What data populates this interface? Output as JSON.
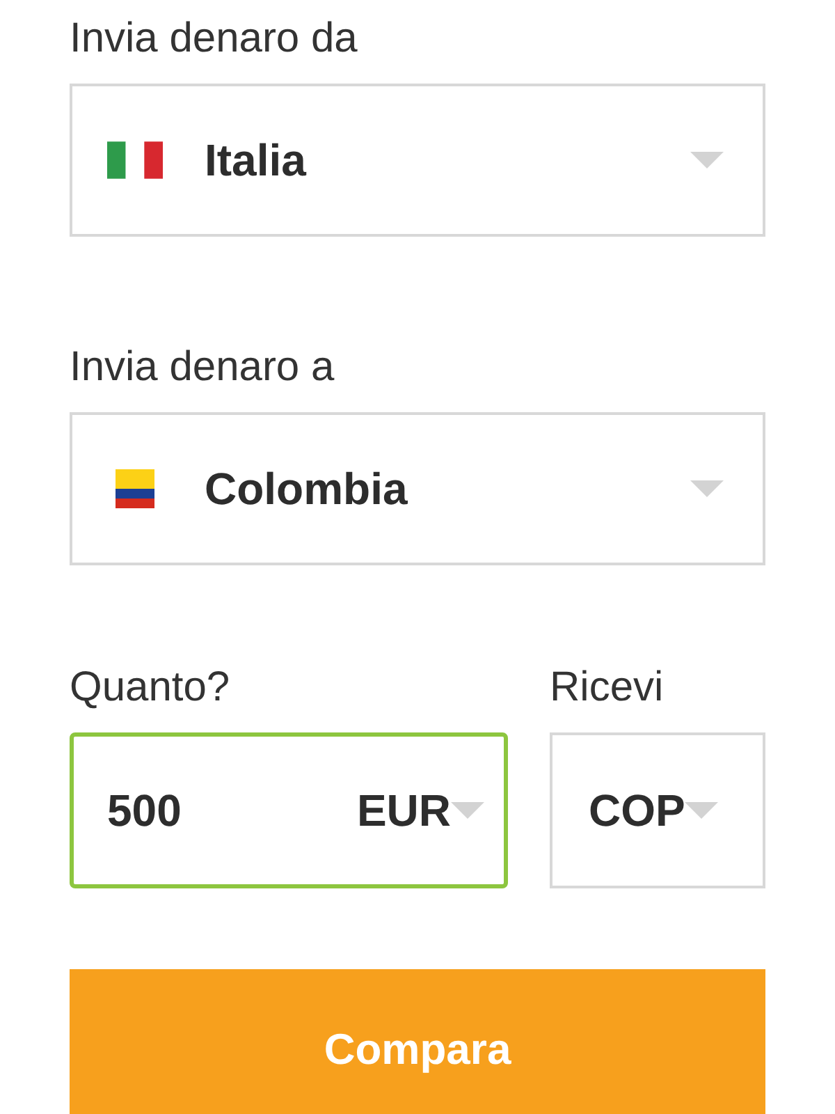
{
  "from": {
    "label": "Invia denaro da",
    "flag": {
      "kind": "italy"
    },
    "country": "Italia"
  },
  "to": {
    "label": "Invia denaro a",
    "flag": {
      "kind": "colombia"
    },
    "country": "Colombia"
  },
  "amount": {
    "label": "Quanto?",
    "value": "500",
    "currency": "EUR",
    "focused": true
  },
  "receive": {
    "label": "Ricevi",
    "currency": "COP",
    "focused": false
  },
  "button": {
    "label": "Compara"
  }
}
